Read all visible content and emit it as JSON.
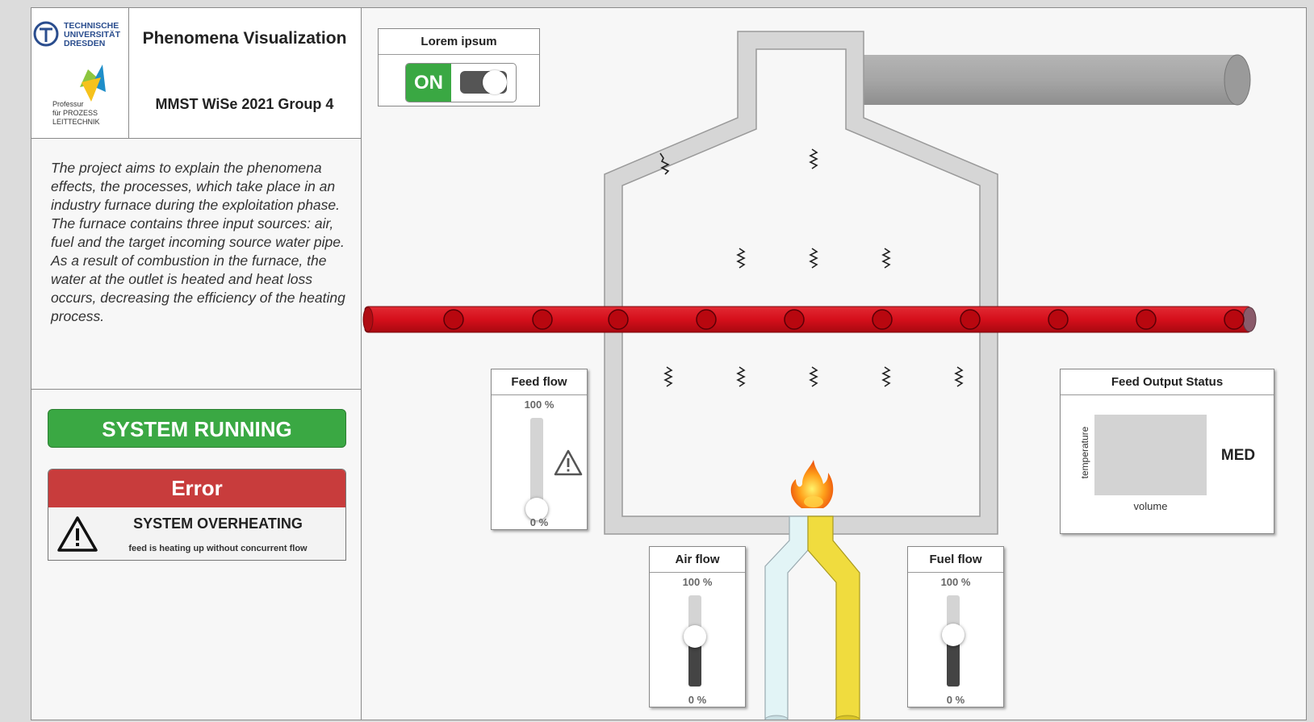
{
  "header": {
    "university_name": [
      "TECHNISCHE",
      "UNIVERSITÄT",
      "DRESDEN"
    ],
    "chair_name": [
      "Professur",
      "für PROZESS",
      "LEITTECHNIK"
    ],
    "title": "Phenomena Visualization",
    "subtitle": "MMST WiSe 2021 Group 4"
  },
  "description": [
    "The project aims to explain the phenomena effects, the processes, which take place in an industry furnace during the exploitation phase.",
    "The furnace contains three input sources: air, fuel and the target incoming source water pipe.",
    "As a result of combustion in the furnace, the water at the outlet is heated and heat loss occurs, decreasing the efficiency of the heating process."
  ],
  "status": {
    "label": "SYSTEM RUNNING",
    "color": "#3aa843"
  },
  "error": {
    "title": "Error",
    "message": "SYSTEM OVERHEATING",
    "detail": "feed is heating up without concurrent flow",
    "color": "#c83c3c",
    "icon": "warning-icon"
  },
  "toggle": {
    "title": "Lorem ipsum",
    "state_label": "ON",
    "on": true,
    "color": "#3aa843"
  },
  "feed_flow": {
    "title": "Feed flow",
    "max_label": "100 %",
    "min_label": "0 %",
    "value_pct": 0,
    "icon": "warning-icon"
  },
  "air_flow": {
    "title": "Air flow",
    "max_label": "100 %",
    "min_label": "0 %",
    "value_pct": 55
  },
  "fuel_flow": {
    "title": "Fuel flow",
    "max_label": "100 %",
    "min_label": "0 %",
    "value_pct": 57
  },
  "output_status": {
    "title": "Feed Output Status",
    "y_label": "temperature",
    "x_label": "volume",
    "level": "MED"
  },
  "colors": {
    "water_pipe": "#d50f1b",
    "air_pipe": "#e2f4f6",
    "fuel_pipe": "#f0dc3e",
    "exhaust_pipe": "#a9a9a9",
    "furnace_wall": "#d6d6d6"
  }
}
